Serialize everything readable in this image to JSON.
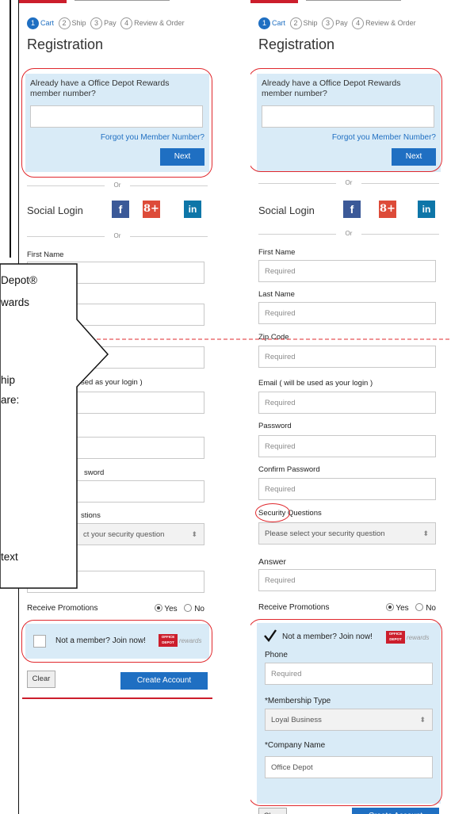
{
  "steps": [
    {
      "num": "1",
      "label": "Cart"
    },
    {
      "num": "2",
      "label": "Ship"
    },
    {
      "num": "3",
      "label": "Pay"
    },
    {
      "num": "4",
      "label": "Review & Order"
    }
  ],
  "title": "Registration",
  "member": {
    "question": "Already have a Office Depot Rewards member number?",
    "forgot": "Forgot you Member Number?",
    "next": "Next"
  },
  "or": "Or",
  "social": {
    "label": "Social Login",
    "facebook": "f",
    "google": "8+",
    "linkedin": "in"
  },
  "form": {
    "first_name": "First Name",
    "last_name": "Last Name",
    "zip": "Zip Code",
    "email": "Email ( will be used as your login )",
    "email_partial": "sed as your login )",
    "password": "Password",
    "confirm_password": "Confirm Password",
    "confirm_partial": "sword",
    "security_q": "Security Questions",
    "security_partial": "stions",
    "security_placeholder": "Please select your security question",
    "security_partial_placeholder": "ct your security question",
    "answer": "Answer",
    "required": "Required"
  },
  "promotions": {
    "label": "Receive Promotions",
    "yes": "Yes",
    "no": "No"
  },
  "join": {
    "text": "Not a member? Join now!",
    "logo": "OFFICE DEPOT",
    "rewards": "rewards"
  },
  "member_extra": {
    "phone": "Phone",
    "membership_type": "*Membership Type",
    "membership_value": "Loyal Business",
    "company_name": "*Company Name",
    "company_value": "Office Depot"
  },
  "buttons": {
    "clear": "Clear",
    "create": "Create Account"
  },
  "callout": {
    "line1": "Depot®",
    "line2": "wards",
    "line3": "hip",
    "line4": "are:",
    "line5": "text"
  }
}
